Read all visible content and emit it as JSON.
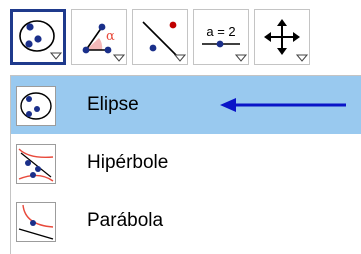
{
  "toolbar": {
    "tools": [
      {
        "icon": "ellipse-icon",
        "selected": true
      },
      {
        "icon": "angle-icon",
        "badge": "α"
      },
      {
        "icon": "line-icon"
      },
      {
        "icon": "slider-icon",
        "badge": "a = 2"
      },
      {
        "icon": "move-icon"
      }
    ]
  },
  "menu": {
    "items": [
      {
        "label": "Elipse",
        "icon": "ellipse-icon",
        "highlighted": true
      },
      {
        "label": "Hipérbole",
        "icon": "hyperbola-icon"
      },
      {
        "label": "Parábola",
        "icon": "parabola-icon"
      }
    ]
  },
  "colors": {
    "selected_border": "#1f3a8c",
    "highlight": "#99c9ef",
    "point": "#1a2f8a",
    "curve": "#e84a3c",
    "arrow": "#0a14c8"
  }
}
